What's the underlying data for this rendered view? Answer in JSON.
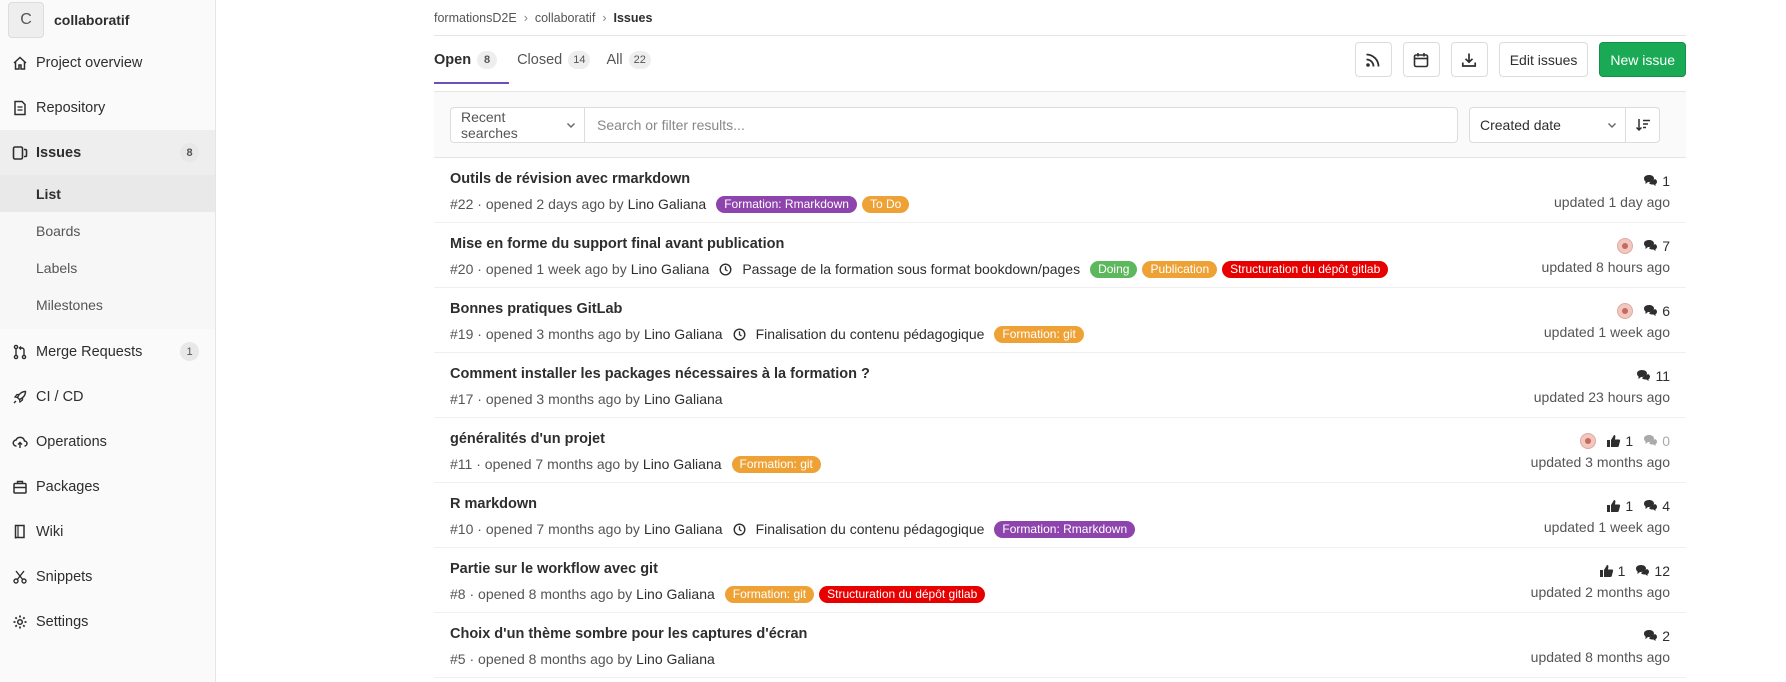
{
  "project": {
    "initial": "C",
    "name": "collaboratif"
  },
  "nav": [
    {
      "key": "overview",
      "label": "Project overview",
      "icon": "home-icon"
    },
    {
      "key": "repository",
      "label": "Repository",
      "icon": "doc-icon"
    },
    {
      "key": "issues",
      "label": "Issues",
      "icon": "issues-icon",
      "badge": "8",
      "active": true
    },
    {
      "key": "mr",
      "label": "Merge Requests",
      "icon": "merge-request-icon",
      "badge": "1"
    },
    {
      "key": "cicd",
      "label": "CI / CD",
      "icon": "rocket-icon"
    },
    {
      "key": "operations",
      "label": "Operations",
      "icon": "cloud-icon"
    },
    {
      "key": "packages",
      "label": "Packages",
      "icon": "package-icon"
    },
    {
      "key": "wiki",
      "label": "Wiki",
      "icon": "book-icon"
    },
    {
      "key": "snippets",
      "label": "Snippets",
      "icon": "scissors-icon"
    },
    {
      "key": "settings",
      "label": "Settings",
      "icon": "gear-icon"
    }
  ],
  "issues_subnav": [
    {
      "label": "List",
      "active": true
    },
    {
      "label": "Boards"
    },
    {
      "label": "Labels"
    },
    {
      "label": "Milestones"
    }
  ],
  "breadcrumb": {
    "group": "formationsD2E",
    "project": "collaboratif",
    "current": "Issues"
  },
  "tabs": [
    {
      "label": "Open",
      "count": "8",
      "active": true
    },
    {
      "label": "Closed",
      "count": "14"
    },
    {
      "label": "All",
      "count": "22"
    }
  ],
  "actions": {
    "edit_label": "Edit issues",
    "new_label": "New issue"
  },
  "filter": {
    "recent_label": "Recent searches",
    "search_placeholder": "Search or filter results...",
    "sort_label": "Created date"
  },
  "colors": {
    "purple": "#8e44ad",
    "orange": "#eea236",
    "green": "#5cb85c",
    "red": "#e80000",
    "accent": "#6b4fbb",
    "primary": "#1aaa55"
  },
  "issues": [
    {
      "title": "Outils de révision avec rmarkdown",
      "ref": "#22",
      "opened": "opened 2 days ago by",
      "author": "Lino Galiana",
      "milestone": "",
      "labels": [
        {
          "text": "Formation: Rmarkdown",
          "color": "#8e44ad"
        },
        {
          "text": "To Do",
          "color": "#eea236"
        }
      ],
      "assignee": false,
      "upvotes": "",
      "comments": "1",
      "comments_zero": false,
      "updated": "updated 1 day ago"
    },
    {
      "title": "Mise en forme du support final avant publication",
      "ref": "#20",
      "opened": "opened 1 week ago by",
      "author": "Lino Galiana",
      "milestone": "Passage de la formation sous format bookdown/pages",
      "labels": [
        {
          "text": "Doing",
          "color": "#5cb85c"
        },
        {
          "text": "Publication",
          "color": "#eea236"
        },
        {
          "text": "Structuration du dépôt gitlab",
          "color": "#e80000"
        }
      ],
      "assignee": true,
      "upvotes": "",
      "comments": "7",
      "comments_zero": false,
      "updated": "updated 8 hours ago"
    },
    {
      "title": "Bonnes pratiques GitLab",
      "ref": "#19",
      "opened": "opened 3 months ago by",
      "author": "Lino Galiana",
      "milestone": "Finalisation du contenu pédagogique",
      "labels": [
        {
          "text": "Formation: git",
          "color": "#eea236"
        }
      ],
      "assignee": true,
      "upvotes": "",
      "comments": "6",
      "comments_zero": false,
      "updated": "updated 1 week ago"
    },
    {
      "title": "Comment installer les packages nécessaires à la formation ?",
      "ref": "#17",
      "opened": "opened 3 months ago by",
      "author": "Lino Galiana",
      "milestone": "",
      "labels": [],
      "assignee": false,
      "upvotes": "",
      "comments": "11",
      "comments_zero": false,
      "updated": "updated 23 hours ago"
    },
    {
      "title": "généralités d'un projet",
      "ref": "#11",
      "opened": "opened 7 months ago by",
      "author": "Lino Galiana",
      "milestone": "",
      "labels": [
        {
          "text": "Formation: git",
          "color": "#eea236"
        }
      ],
      "assignee": true,
      "upvotes": "1",
      "comments": "0",
      "comments_zero": true,
      "updated": "updated 3 months ago"
    },
    {
      "title": "R markdown",
      "ref": "#10",
      "opened": "opened 7 months ago by",
      "author": "Lino Galiana",
      "milestone": "Finalisation du contenu pédagogique",
      "labels": [
        {
          "text": "Formation: Rmarkdown",
          "color": "#8e44ad"
        }
      ],
      "assignee": false,
      "upvotes": "1",
      "comments": "4",
      "comments_zero": false,
      "updated": "updated 1 week ago"
    },
    {
      "title": "Partie sur le workflow avec git",
      "ref": "#8",
      "opened": "opened 8 months ago by",
      "author": "Lino Galiana",
      "milestone": "",
      "labels": [
        {
          "text": "Formation: git",
          "color": "#eea236"
        },
        {
          "text": "Structuration du dépôt gitlab",
          "color": "#e80000"
        }
      ],
      "assignee": false,
      "upvotes": "1",
      "comments": "12",
      "comments_zero": false,
      "updated": "updated 2 months ago"
    },
    {
      "title": "Choix d'un thème sombre pour les captures d'écran",
      "ref": "#5",
      "opened": "opened 8 months ago by",
      "author": "Lino Galiana",
      "milestone": "",
      "labels": [],
      "assignee": false,
      "upvotes": "",
      "comments": "2",
      "comments_zero": false,
      "updated": "updated 8 months ago"
    }
  ]
}
